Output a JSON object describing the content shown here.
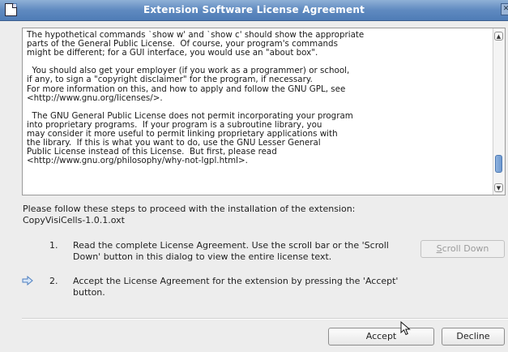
{
  "window": {
    "title": "Extension Software License Agreement",
    "icons": {
      "app": "document-icon",
      "close": "close-icon"
    }
  },
  "license": {
    "text": "The hypothetical commands `show w' and `show c' should show the appropriate\nparts of the General Public License.  Of course, your program's commands\nmight be different; for a GUI interface, you would use an \"about box\".\n\n  You should also get your employer (if you work as a programmer) or school,\nif any, to sign a \"copyright disclaimer\" for the program, if necessary.\nFor more information on this, and how to apply and follow the GNU GPL, see\n<http://www.gnu.org/licenses/>.\n\n  The GNU General Public License does not permit incorporating your program\ninto proprietary programs.  If your program is a subroutine library, you\nmay consider it more useful to permit linking proprietary applications with\nthe library.  If this is what you want to do, use the GNU Lesser General\nPublic License instead of this License.  But first, please read\n<http://www.gnu.org/philosophy/why-not-lgpl.html>.",
    "scroll_position": 0.93
  },
  "instructions": {
    "intro_line1": "Please follow these steps to proceed with the installation of the extension:",
    "intro_line2": "CopyVisiCells-1.0.1.oxt",
    "steps": [
      {
        "number": "1.",
        "line1": "Read the complete License Agreement. Use the scroll bar or the 'Scroll",
        "line2": "Down' button in this dialog to view the entire license text."
      },
      {
        "number": "2.",
        "line1": "Accept the License Agreement for the extension by pressing the 'Accept'",
        "line2": "button.",
        "current": true
      }
    ]
  },
  "buttons": {
    "scroll_down_mnemonic": "S",
    "scroll_down_rest": "croll Down",
    "scroll_down_enabled": false,
    "accept": "Accept",
    "decline": "Decline"
  }
}
